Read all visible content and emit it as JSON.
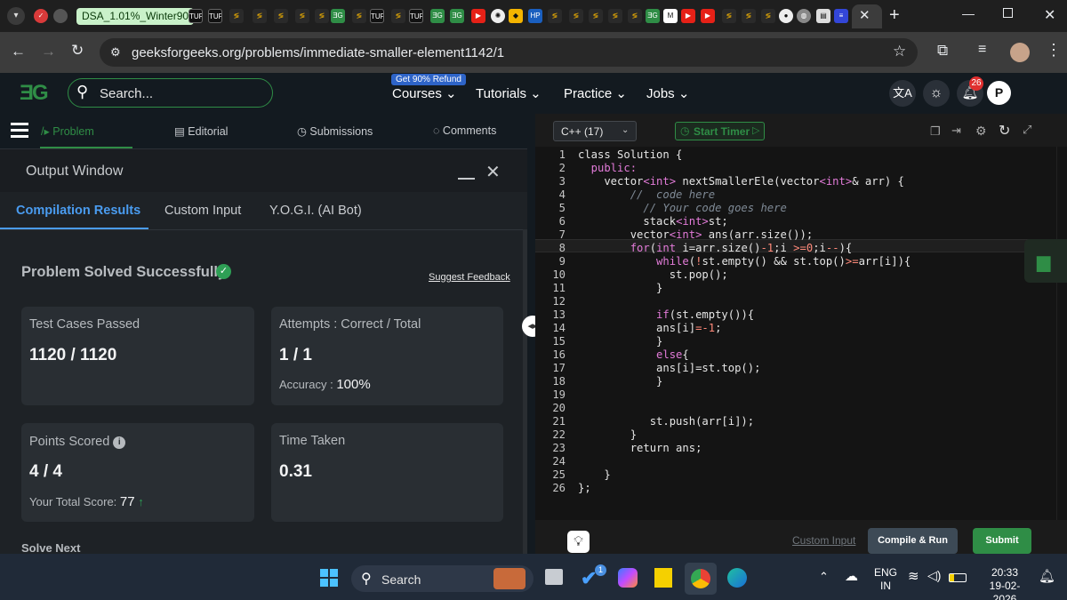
{
  "browser": {
    "tab_group_label": "DSA_1.01%_Winter90",
    "url": "geeksforgeeks.org/problems/immediate-smaller-element1142/1"
  },
  "gfg": {
    "search_placeholder": "Search...",
    "refund_badge": "Get 90% Refund",
    "nav": [
      "Courses",
      "Tutorials",
      "Practice",
      "Jobs"
    ],
    "notifications_count": "26",
    "avatar_initial": "P"
  },
  "left_tabs": {
    "problem": "Problem",
    "editorial": "Editorial",
    "submissions": "Submissions",
    "comments": "Comments"
  },
  "output_window": {
    "title": "Output Window",
    "tabs": [
      "Compilation Results",
      "Custom Input",
      "Y.O.G.I. (AI Bot)"
    ],
    "status": "Problem Solved Successfully",
    "suggest_feedback": "Suggest Feedback",
    "test_cases_label": "Test Cases Passed",
    "test_cases_value": "1120 / 1120",
    "attempts_label": "Attempts : Correct / Total",
    "attempts_value": "1 / 1",
    "accuracy_label": "Accuracy :",
    "accuracy_value": "100%",
    "points_label": "Points Scored",
    "points_value": "4 / 4",
    "total_score_label": "Your Total Score:",
    "total_score_value": "77",
    "time_label": "Time Taken",
    "time_value": "0.31",
    "solve_next": "Solve Next"
  },
  "editor": {
    "language": "C++ (17)",
    "start_timer": "Start Timer",
    "line_numbers": [
      "1",
      "2",
      "3",
      "4",
      "5",
      "6",
      "7",
      "8",
      "9",
      "10",
      "11",
      "12",
      "13",
      "14",
      "15",
      "16",
      "17",
      "18",
      "19",
      "20",
      "21",
      "22",
      "23",
      "24",
      "25",
      "26"
    ],
    "custom_input": "Custom Input",
    "compile_run": "Compile & Run",
    "submit": "Submit"
  },
  "code_lines": [
    [
      {
        "t": "class Solution {",
        "c": ""
      }
    ],
    [
      {
        "t": "  public:",
        "c": "kw"
      }
    ],
    [
      {
        "t": "    vector",
        "c": ""
      },
      {
        "t": "<int>",
        "c": "kw"
      },
      {
        "t": " nextSmallerEle(vector",
        "c": ""
      },
      {
        "t": "<int>",
        "c": "kw"
      },
      {
        "t": "& arr) {",
        "c": ""
      }
    ],
    [
      {
        "t": "        //  code here",
        "c": "cm"
      }
    ],
    [
      {
        "t": "          // Your code goes here",
        "c": "cm"
      }
    ],
    [
      {
        "t": "          stack",
        "c": ""
      },
      {
        "t": "<int>",
        "c": "kw"
      },
      {
        "t": "st;",
        "c": ""
      }
    ],
    [
      {
        "t": "        vector",
        "c": ""
      },
      {
        "t": "<int>",
        "c": "kw"
      },
      {
        "t": " ans(arr.size());",
        "c": ""
      }
    ],
    [
      {
        "t": "        for",
        "c": "kw"
      },
      {
        "t": "(",
        "c": ""
      },
      {
        "t": "int",
        "c": "kw"
      },
      {
        "t": " i=arr.size()",
        "c": ""
      },
      {
        "t": "-1",
        "c": "op"
      },
      {
        "t": ";i ",
        "c": ""
      },
      {
        "t": ">=0",
        "c": "op"
      },
      {
        "t": ";i",
        "c": ""
      },
      {
        "t": "--",
        "c": "op"
      },
      {
        "t": "){",
        "c": ""
      }
    ],
    [
      {
        "t": "            while",
        "c": "kw"
      },
      {
        "t": "(",
        "c": ""
      },
      {
        "t": "!",
        "c": "op"
      },
      {
        "t": "st.empty() && st.top()",
        "c": ""
      },
      {
        "t": ">=",
        "c": "op"
      },
      {
        "t": "arr[i]){",
        "c": ""
      }
    ],
    [
      {
        "t": "              st.pop();",
        "c": ""
      }
    ],
    [
      {
        "t": "            }",
        "c": ""
      }
    ],
    [
      {
        "t": "",
        "c": ""
      }
    ],
    [
      {
        "t": "            if",
        "c": "kw"
      },
      {
        "t": "(st.empty()){",
        "c": ""
      }
    ],
    [
      {
        "t": "            ans[i]",
        "c": ""
      },
      {
        "t": "=-1",
        "c": "op"
      },
      {
        "t": ";",
        "c": ""
      }
    ],
    [
      {
        "t": "            }",
        "c": ""
      }
    ],
    [
      {
        "t": "            else",
        "c": "kw"
      },
      {
        "t": "{",
        "c": ""
      }
    ],
    [
      {
        "t": "            ans[i]=st.top();",
        "c": ""
      }
    ],
    [
      {
        "t": "            }",
        "c": ""
      }
    ],
    [
      {
        "t": "",
        "c": ""
      }
    ],
    [
      {
        "t": "",
        "c": ""
      }
    ],
    [
      {
        "t": "           st.push(arr[i]);",
        "c": ""
      }
    ],
    [
      {
        "t": "        }",
        "c": ""
      }
    ],
    [
      {
        "t": "        return ans;",
        "c": ""
      }
    ],
    [
      {
        "t": "",
        "c": ""
      }
    ],
    [
      {
        "t": "    }",
        "c": ""
      }
    ],
    [
      {
        "t": "};",
        "c": ""
      }
    ]
  ],
  "taskbar": {
    "search": "Search",
    "lang_top": "ENG",
    "lang_bottom": "IN",
    "time": "20:33",
    "date": "19-02-2026",
    "todo_badge": "1"
  },
  "colors": {
    "gfg_green": "#2f8d46",
    "success_green": "#2e9f55",
    "accent_blue": "#4a9cf0",
    "notification_red": "#e02f2f"
  }
}
